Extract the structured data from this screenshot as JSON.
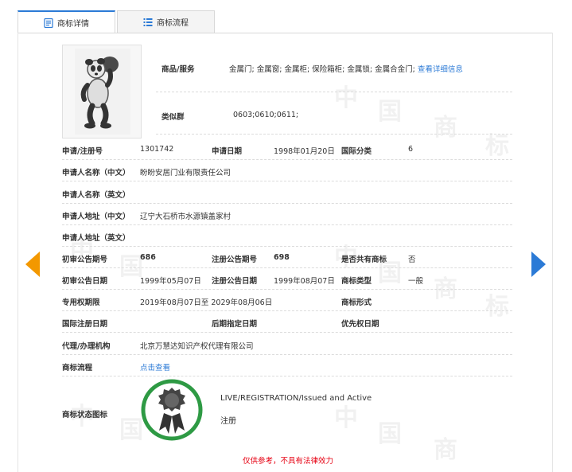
{
  "tabs": [
    {
      "label": "商标详情",
      "icon": "document-icon",
      "active": true
    },
    {
      "label": "商标流程",
      "icon": "list-icon",
      "active": false
    }
  ],
  "header": {
    "goods_label": "商品/服务",
    "goods_value": "金属门; 金属窗; 金属柜; 保险箱柜; 金属锁; 金属合金门;",
    "goods_link": "查看详细信息",
    "group_label": "类似群",
    "group_value": "0603;0610;0611;"
  },
  "fields": {
    "reg_no_label": "申请/注册号",
    "reg_no": "1301742",
    "apply_date_label": "申请日期",
    "apply_date": "1998年01月20日",
    "intl_class_label": "国际分类",
    "intl_class": "6",
    "applicant_cn_label": "申请人名称（中文）",
    "applicant_cn": "盼盼安居门业有限责任公司",
    "applicant_en_label": "申请人名称（英文）",
    "address_cn_label": "申请人地址（中文）",
    "address_cn": "辽宁大石桥市水源镇盖家村",
    "address_en_label": "申请人地址（英文）",
    "prelim_no_label": "初审公告期号",
    "prelim_no": "686",
    "reg_notice_no_label": "注册公告期号",
    "reg_notice_no": "698",
    "shared_label": "是否共有商标",
    "shared": "否",
    "prelim_date_label": "初审公告日期",
    "prelim_date": "1999年05月07日",
    "reg_notice_date_label": "注册公告日期",
    "reg_notice_date": "1999年08月07日",
    "type_label": "商标类型",
    "type": "一般",
    "exclusive_label": "专用权期限",
    "exclusive": "2019年08月07日至 2029年08月06日",
    "form_label": "商标形式",
    "intl_reg_date_label": "国际注册日期",
    "later_date_label": "后期指定日期",
    "priority_label": "优先权日期",
    "agent_label": "代理/办理机构",
    "agent": "北京万慧达知识产权代理有限公司",
    "process_label": "商标流程",
    "process_link": "点击查看",
    "status_icon_label": "商标状态图标",
    "status_en": "LIVE/REGISTRATION/Issued and Active",
    "status_cn": "注册"
  },
  "watermark": [
    "中",
    "国",
    "商",
    "标"
  ],
  "disclaimer": "仅供参考，不具有法律效力",
  "colors": {
    "accent": "#2b7ad6",
    "prev_arrow": "#f39800",
    "seal": "#2e9a44",
    "warning": "#e60012"
  }
}
